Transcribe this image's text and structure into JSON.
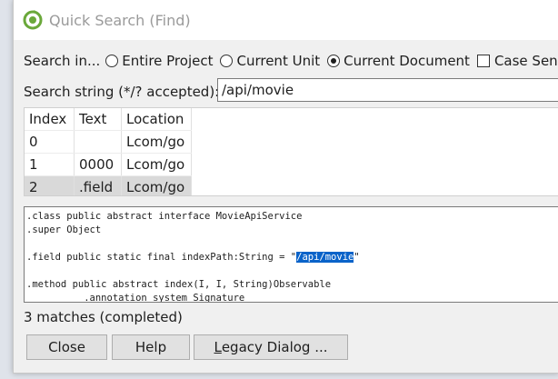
{
  "window": {
    "title": "Quick Search (Find)"
  },
  "scope": {
    "label": "Search in...",
    "options": [
      {
        "label": "Entire Project",
        "selected": false
      },
      {
        "label": "Current Unit",
        "selected": false
      },
      {
        "label": "Current Document",
        "selected": true
      }
    ],
    "case_sensitive_label": "Case Sensi",
    "case_sensitive_checked": false
  },
  "search": {
    "label": "Search string (*/? accepted):",
    "value": "/api/movie"
  },
  "results": {
    "columns": [
      "Index",
      "Text",
      "Location"
    ],
    "rows": [
      {
        "index": "0",
        "text": "",
        "location": "Lcom/go"
      },
      {
        "index": "1",
        "text": "0000",
        "location": "Lcom/go"
      },
      {
        "index": "2",
        "text": ".field",
        "location": "Lcom/go"
      }
    ],
    "selected_row": 2
  },
  "code": {
    "line1": ".class public abstract interface MovieApiService",
    "line2": ".super Object",
    "line3": "",
    "line4_prefix": ".field public static final indexPath:String = \"",
    "line4_match": "/api/movie",
    "line4_suffix": "\"",
    "line5": "",
    "line6": ".method public abstract index(I, I, String)Observable",
    "line7": "          .annotation system Signature"
  },
  "status": {
    "text": "3 matches (completed)"
  },
  "buttons": {
    "close": "Close",
    "help": "Help",
    "legacy_first": "L",
    "legacy_rest": "egacy Dialog ..."
  },
  "colors": {
    "selection_highlight": "#0a63c9",
    "selected_row": "#d9d9d9"
  }
}
